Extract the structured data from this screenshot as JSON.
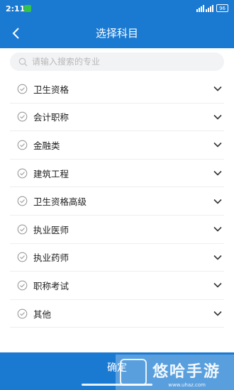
{
  "status_bar": {
    "time": "2:11",
    "battery": "96"
  },
  "header": {
    "title": "选择科目"
  },
  "search": {
    "placeholder": "请输入搜索的专业"
  },
  "subjects": [
    {
      "label": "卫生资格"
    },
    {
      "label": "会计职称"
    },
    {
      "label": "金融类"
    },
    {
      "label": "建筑工程"
    },
    {
      "label": "卫生资格高级"
    },
    {
      "label": "执业医师"
    },
    {
      "label": "执业药师"
    },
    {
      "label": "职称考试"
    },
    {
      "label": "其他"
    }
  ],
  "footer": {
    "confirm_label": "确定"
  },
  "watermark": {
    "text": "悠哈手游",
    "url": "www.uhaz.com"
  },
  "colors": {
    "primary": "#1a7ad2",
    "divider": "#eeeeee",
    "text": "#222222"
  }
}
